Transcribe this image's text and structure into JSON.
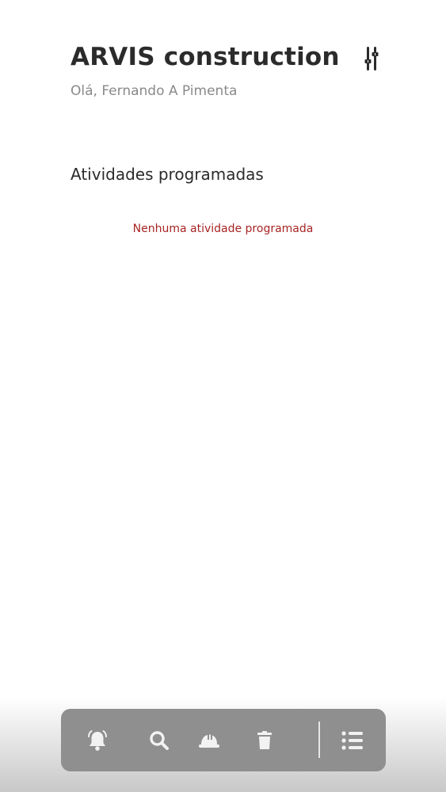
{
  "header": {
    "title": "ARVIS construction",
    "greeting": "Olá, Fernando A Pimenta",
    "settings_icon": "sliders-icon"
  },
  "activities": {
    "section_title": "Atividades programadas",
    "empty_message": "Nenhuma atividade programada",
    "empty_color": "#a82424"
  },
  "bottom_nav": {
    "background": "#8f8f8f",
    "icon_color": "#f2f2f2",
    "items": [
      {
        "icon": "bell-alarm-icon"
      },
      {
        "icon": "search-icon"
      },
      {
        "icon": "hard-hat-icon"
      },
      {
        "icon": "trash-icon"
      },
      {
        "icon": "list-icon"
      }
    ]
  }
}
